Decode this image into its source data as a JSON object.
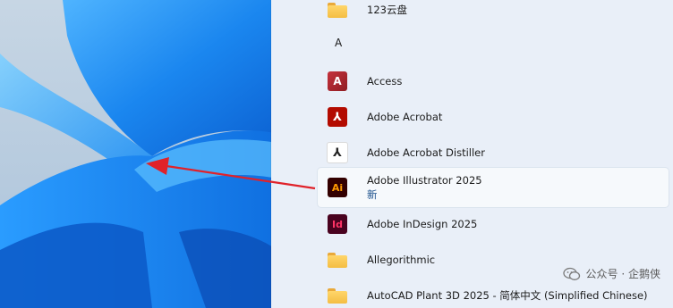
{
  "start_menu": {
    "section_letter": "A",
    "items": [
      {
        "label": "123云盘",
        "icon": "folder-icon"
      },
      {
        "label": "Access",
        "icon": "access-icon",
        "glyph": "A"
      },
      {
        "label": "Adobe Acrobat",
        "icon": "acrobat-icon",
        "glyph": "⅄"
      },
      {
        "label": "Adobe Acrobat Distiller",
        "icon": "distiller-icon",
        "glyph": "⅄"
      },
      {
        "label": "Adobe Illustrator 2025",
        "sub": "新",
        "icon": "illustrator-icon",
        "glyph": "Ai"
      },
      {
        "label": "Adobe InDesign 2025",
        "icon": "indesign-icon",
        "glyph": "Id"
      },
      {
        "label": "Allegorithmic",
        "icon": "folder-icon"
      },
      {
        "label": "AutoCAD Plant 3D 2025 - 简体中文 (Simplified Chinese)",
        "icon": "folder-icon"
      }
    ]
  },
  "watermark": {
    "text": "公众号 · 企鹅侠"
  },
  "colors": {
    "arrow": "#e0222a",
    "panel_bg": "#e9eff8",
    "wallpaper_blue": "#1e88f0"
  }
}
